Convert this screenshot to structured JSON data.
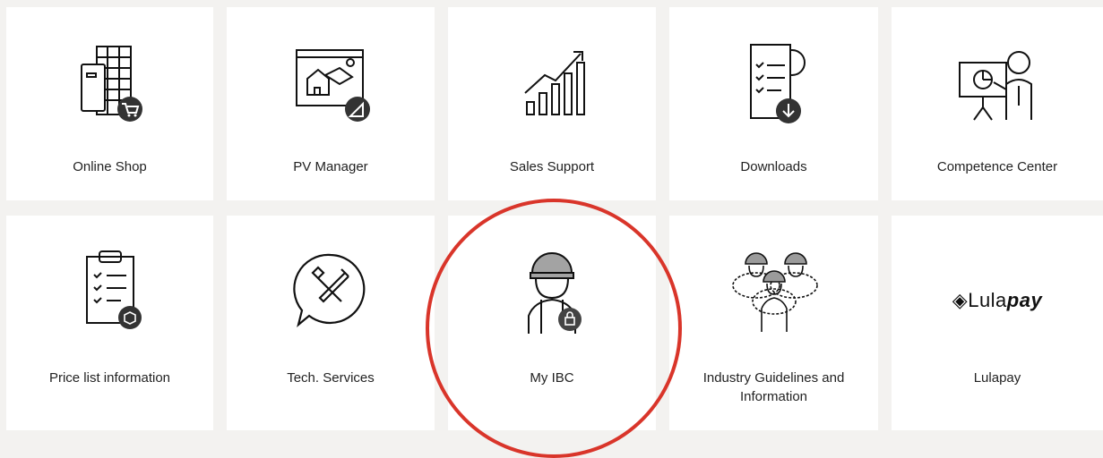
{
  "tiles": [
    {
      "label": "Online Shop",
      "icon": "solar-panel-cart-icon"
    },
    {
      "label": "PV Manager",
      "icon": "house-solar-window-icon"
    },
    {
      "label": "Sales Support",
      "icon": "growth-chart-icon"
    },
    {
      "label": "Downloads",
      "icon": "document-gear-download-icon"
    },
    {
      "label": "Competence Center",
      "icon": "presenter-board-icon"
    },
    {
      "label": "Price list information",
      "icon": "clipboard-checklist-icon"
    },
    {
      "label": "Tech. Services",
      "icon": "wrench-screwdriver-bubble-icon"
    },
    {
      "label": "My IBC",
      "icon": "worker-lock-icon"
    },
    {
      "label": "Industry Guidelines and\nInformation",
      "icon": "worker-group-icon"
    },
    {
      "label": "Lulapay",
      "icon": "lulapay-logo"
    }
  ],
  "lulapay_logo": {
    "text_plain": "Lula",
    "text_bold": "pay"
  },
  "colors": {
    "highlight": "#d9352a",
    "background": "#f3f2f0",
    "tile": "#ffffff"
  }
}
